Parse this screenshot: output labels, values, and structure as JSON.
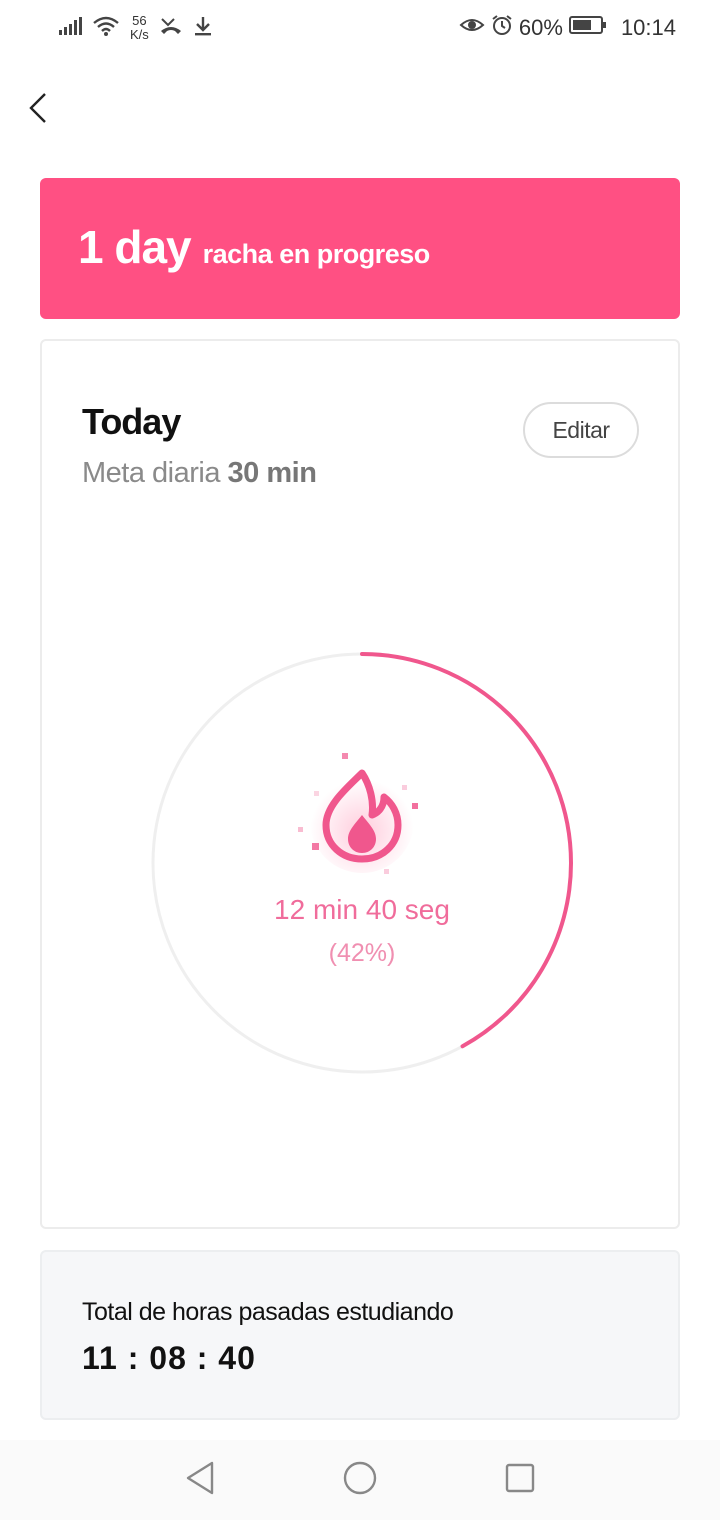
{
  "status_bar": {
    "speed_value": "56",
    "speed_unit": "K/s",
    "battery": "60%",
    "time": "10:14",
    "icons": [
      "signal-icon",
      "wifi-icon",
      "missed-call-icon",
      "download-icon",
      "eye-icon",
      "alarm-icon",
      "battery-icon"
    ]
  },
  "header": {
    "back_icon": "chevron-left-icon"
  },
  "streak": {
    "days": "1 day",
    "label": "racha en progreso",
    "color": "#ff5083"
  },
  "today": {
    "title": "Today",
    "goal_label": "Meta diaria",
    "goal_value": "30 min",
    "edit_label": "Editar",
    "progress_text": "12 min 40 seg",
    "percent_text": "(42%)",
    "progress_fraction": 0.42,
    "accent_color": "#f0578d",
    "icon": "flame-icon"
  },
  "total": {
    "label": "Total de horas pasadas estudiando",
    "value": "11 : 08 : 40"
  },
  "nav_bar": {
    "icons": [
      "back-triangle-icon",
      "home-circle-icon",
      "recents-square-icon"
    ]
  }
}
